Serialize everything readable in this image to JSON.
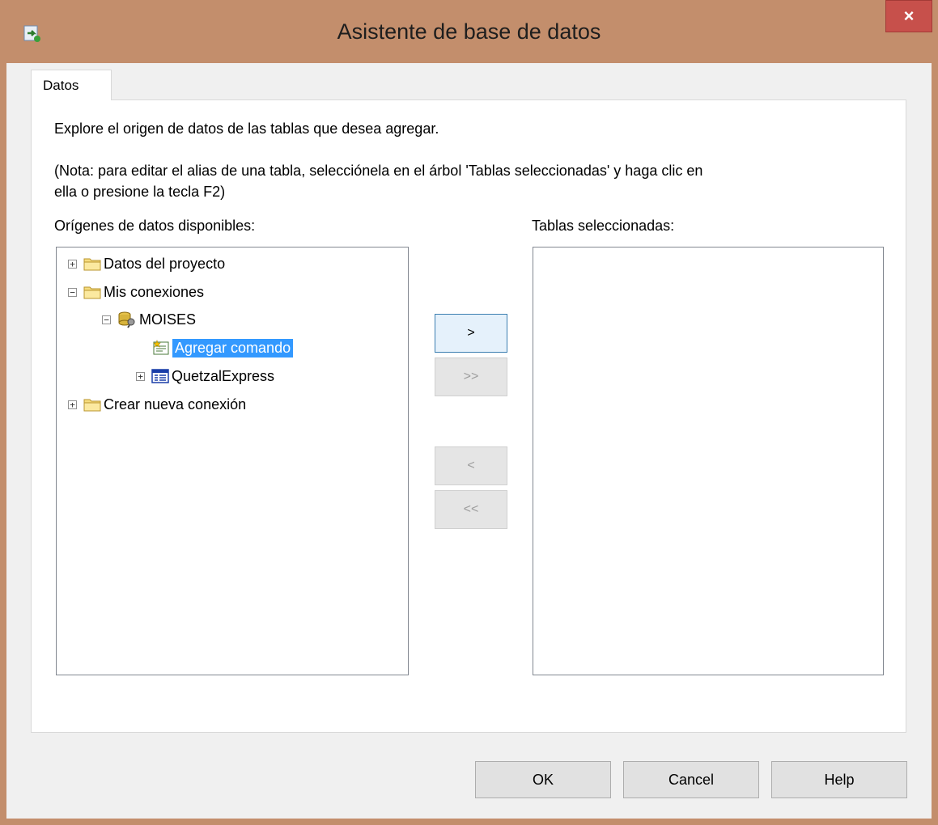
{
  "window": {
    "title": "Asistente de base de datos",
    "close_label": "×"
  },
  "tabs": [
    {
      "label": "Datos"
    }
  ],
  "instructions": {
    "line1": "Explore el origen de datos de las tablas que desea agregar.",
    "line2": "(Nota: para editar el alias de una tabla, selecciónela en el árbol 'Tablas seleccionadas' y haga clic en",
    "line3": "ella o presione la tecla F2)"
  },
  "available": {
    "label": "Orígenes de datos disponibles:",
    "tree": [
      {
        "label": "Datos del proyecto",
        "expander": "+"
      },
      {
        "label": "Mis conexiones",
        "expander": "−"
      },
      {
        "label": "MOISES",
        "expander": "−"
      },
      {
        "label": "Agregar comando",
        "selected": true
      },
      {
        "label": "QuetzalExpress",
        "expander": "+"
      },
      {
        "label": "Crear nueva conexión",
        "expander": "+"
      }
    ]
  },
  "selected_tables": {
    "label": "Tablas seleccionadas:"
  },
  "transfer_buttons": {
    "add": ">",
    "add_all": ">>",
    "remove": "<",
    "remove_all": "<<"
  },
  "dialog_buttons": {
    "ok": "OK",
    "cancel": "Cancel",
    "help": "Help"
  },
  "colors": {
    "frame": "#c38e6c",
    "close_button": "#c7504b",
    "selection": "#3399ff",
    "client": "#f0f0f0"
  }
}
